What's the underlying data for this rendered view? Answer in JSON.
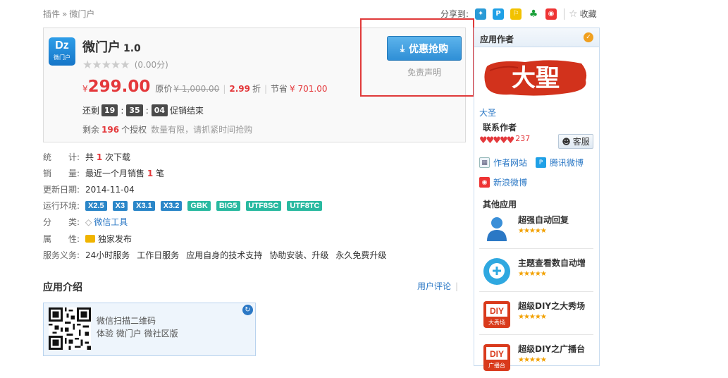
{
  "breadcrumb": {
    "items": [
      "插件",
      "微门户"
    ],
    "sep": "»"
  },
  "share": {
    "label": "分享到:",
    "favorite": "收藏"
  },
  "product": {
    "logo_text": "Dz",
    "logo_sub": "微门户",
    "name": "微门户",
    "version": "1.0",
    "rating_stars": "★★★★★",
    "rating_score": "(0.00分)",
    "currency": "¥",
    "price": "299.00",
    "orig_label": "原价",
    "orig_price": "¥ 1,000.00",
    "discount": "2.99",
    "discount_unit": "折",
    "save_label": "节省",
    "save_amount": "¥ 701.00",
    "countdown_prefix": "还剩",
    "countdown_h": "19",
    "countdown_m": "35",
    "countdown_s": "04",
    "countdown_suffix": "促销结束",
    "remain_prefix": "剩余",
    "remain_count": "196",
    "remain_unit": "个授权",
    "remain_note": "数量有限，请抓紧时间抢购",
    "buy_button": "优惠抢购",
    "disclaimer": "免责声明"
  },
  "info": {
    "stats_key": "统　　计:",
    "stats_pre": "共",
    "stats_num": "1",
    "stats_suf": "次下载",
    "sales_key": "销　　量:",
    "sales_pre": "最近一个月销售",
    "sales_num": "1",
    "sales_suf": "笔",
    "updated_key": "更新日期:",
    "updated_val": "2014-11-04",
    "env_key": "运行环境:",
    "env_blue": [
      "X2.5",
      "X3",
      "X3.1",
      "X3.2"
    ],
    "env_green": [
      "GBK",
      "BIG5",
      "UTF8SC",
      "UTF8TC"
    ],
    "category_key": "分　　类:",
    "category_val": "微信工具",
    "attr_key": "属　　性:",
    "attr_val": "独家发布",
    "service_key": "服务义务:",
    "services": [
      "24小时服务",
      "工作日服务",
      "应用自身的技术支持",
      "协助安装、升级",
      "永久免费升级"
    ]
  },
  "intro": {
    "title": "应用介绍",
    "reviews": "用户评论",
    "qr_line1": "微信扫描二维码",
    "qr_line2": "体验 微门户 微社区版"
  },
  "sidebar": {
    "title": "应用作者",
    "seal_text": "大聖",
    "author_name": "大圣",
    "contact_title": "联系作者",
    "hearts": "♥♥♥♥♥",
    "heart_count": "237",
    "kefu": "客服",
    "links": [
      "作者网站",
      "腾讯微博",
      "新浪微博"
    ],
    "other_title": "其他应用",
    "apps": [
      {
        "name": "超强自动回复",
        "stars": "★★★★★"
      },
      {
        "name": "主题查看数自动增",
        "stars": "★★★★★"
      },
      {
        "name": "超级DIY之大秀场",
        "stars": "★★★★★"
      },
      {
        "name": "超级DIY之广播台",
        "stars": "★★★★★"
      }
    ],
    "diy_label": "DIY",
    "diy_sub1": "大秀场",
    "diy_sub2": "广播台"
  },
  "colors": {
    "accent": "#2b78c5",
    "price_red": "#e4393c",
    "highlight_box": "#e03a3a"
  }
}
